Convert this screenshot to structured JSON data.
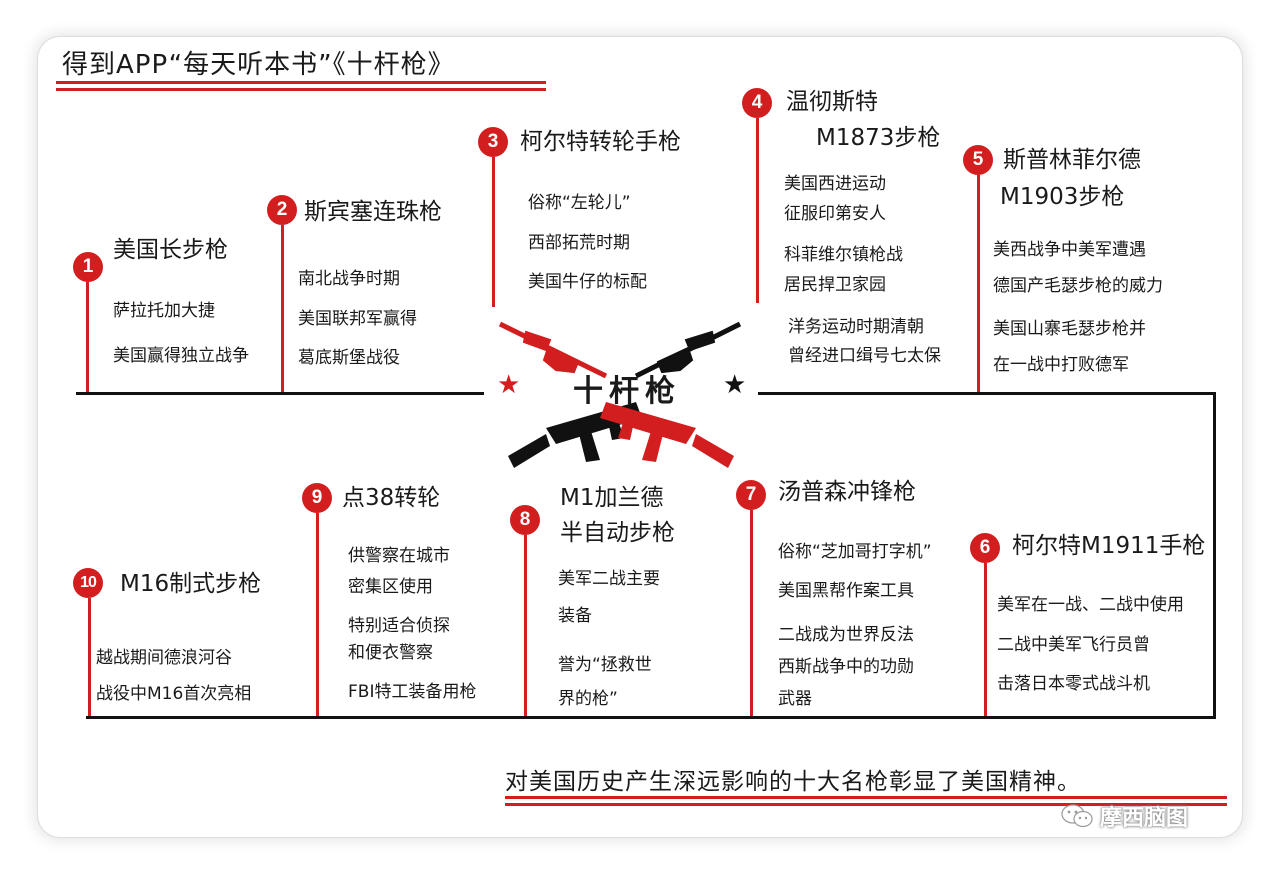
{
  "header": {
    "title": "得到APP“每天听本书”《十杆枪》"
  },
  "center": {
    "title": "十杆枪"
  },
  "guns": [
    {
      "num": "1",
      "title": "美国长步枪",
      "lines": [
        "萨拉托加大捷",
        "美国赢得独立战争"
      ]
    },
    {
      "num": "2",
      "title": "斯宾塞连珠枪",
      "lines": [
        "南北战争时期",
        "美国联邦军赢得",
        "葛底斯堡战役"
      ]
    },
    {
      "num": "3",
      "title": "柯尔特转轮手枪",
      "lines": [
        "俗称“左轮儿”",
        "西部拓荒时期",
        "美国牛仔的标配"
      ]
    },
    {
      "num": "4",
      "title": "温彻斯特",
      "title2": "M1873步枪",
      "lines": [
        "美国西进运动",
        "征服印第安人",
        "科菲维尔镇枪战",
        "居民捍卫家园",
        "洋务运动时期清朝",
        "曾经进口缉号七太保"
      ]
    },
    {
      "num": "5",
      "title": "斯普林菲尔德",
      "title2": "M1903步枪",
      "lines": [
        "美西战争中美军遭遇",
        "德国产毛瑟步枪的威力",
        "美国山寨毛瑟步枪并",
        "在一战中打败德军"
      ]
    },
    {
      "num": "6",
      "title": "柯尔特M1911手枪",
      "lines": [
        "美军在一战、二战中使用",
        "二战中美军飞行员曾",
        "击落日本零式战斗机"
      ]
    },
    {
      "num": "7",
      "title": "汤普森冲锋枪",
      "lines": [
        "俗称“芝加哥打字机”",
        "美国黑帮作案工具",
        "二战成为世界反法",
        "西斯战争中的功勋",
        "武器"
      ]
    },
    {
      "num": "8",
      "title": "M1加兰德",
      "title2": "半自动步枪",
      "lines": [
        "美军二战主要",
        "装备",
        "誉为“拯救世",
        "界的枪”"
      ]
    },
    {
      "num": "9",
      "title": "点38转轮",
      "lines": [
        "供警察在城市",
        "密集区使用",
        "特别适合侦探",
        "和便衣警察",
        "FBI特工装备用枪"
      ]
    },
    {
      "num": "10",
      "title": "M16制式步枪",
      "lines": [
        "越战期间德浪河谷",
        "战役中M16首次亮相"
      ]
    }
  ],
  "footer": {
    "text": "对美国历史产生深远影响的十大名枪彰显了美国精神。"
  },
  "brand": {
    "name": "摩西脑图"
  },
  "colors": {
    "accent": "#d21e1e",
    "ink": "#111111"
  }
}
